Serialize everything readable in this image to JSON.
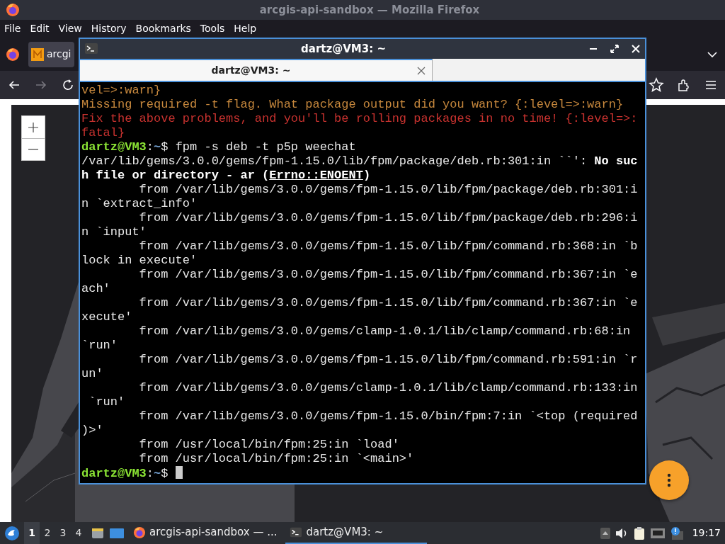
{
  "firefox": {
    "title": "arcgis-api-sandbox — Mozilla Firefox",
    "menu": [
      "File",
      "Edit",
      "View",
      "History",
      "Bookmarks",
      "Tools",
      "Help"
    ],
    "tab": {
      "label": "arcgi"
    }
  },
  "terminal": {
    "title": "dartz@VM3: ~",
    "tabs": [
      {
        "label": "dartz@VM3: ~",
        "selected": true
      }
    ],
    "cursor_visible": true,
    "lines": [
      [
        {
          "text": "vel=>:warn}",
          "kind": "warn"
        }
      ],
      [
        {
          "text": "Missing required -t flag. What package output did you want? {:level=>:warn}",
          "kind": "warn"
        }
      ],
      [
        {
          "text": "Fix the above problems, and you'll be rolling packages in no time! {:level=>:",
          "kind": "error"
        }
      ],
      [
        {
          "text": "fatal}",
          "kind": "error"
        }
      ],
      [
        {
          "text": "dartz@VM3",
          "kind": "user"
        },
        {
          "text": ":",
          "kind": "plain"
        },
        {
          "text": "~",
          "kind": "path"
        },
        {
          "text": "$ fpm -s deb -t p5p weechat",
          "kind": "plain"
        }
      ],
      [
        {
          "text": "/var/lib/gems/3.0.0/gems/fpm-1.15.0/lib/fpm/package/deb.rb:301:in ``': ",
          "kind": "plain"
        },
        {
          "text": "No suc",
          "kind": "bold"
        }
      ],
      [
        {
          "text": "h file or directory - ar (",
          "kind": "bold"
        },
        {
          "text": "Errno::ENOENT",
          "kind": "link"
        },
        {
          "text": ")",
          "kind": "bold"
        }
      ],
      [
        {
          "text": "        from /var/lib/gems/3.0.0/gems/fpm-1.15.0/lib/fpm/package/deb.rb:301:i",
          "kind": "plain"
        }
      ],
      [
        {
          "text": "n `extract_info'",
          "kind": "plain"
        }
      ],
      [
        {
          "text": "        from /var/lib/gems/3.0.0/gems/fpm-1.15.0/lib/fpm/package/deb.rb:296:i",
          "kind": "plain"
        }
      ],
      [
        {
          "text": "n `input'",
          "kind": "plain"
        }
      ],
      [
        {
          "text": "        from /var/lib/gems/3.0.0/gems/fpm-1.15.0/lib/fpm/command.rb:368:in `b",
          "kind": "plain"
        }
      ],
      [
        {
          "text": "lock in execute'",
          "kind": "plain"
        }
      ],
      [
        {
          "text": "        from /var/lib/gems/3.0.0/gems/fpm-1.15.0/lib/fpm/command.rb:367:in `e",
          "kind": "plain"
        }
      ],
      [
        {
          "text": "ach'",
          "kind": "plain"
        }
      ],
      [
        {
          "text": "        from /var/lib/gems/3.0.0/gems/fpm-1.15.0/lib/fpm/command.rb:367:in `e",
          "kind": "plain"
        }
      ],
      [
        {
          "text": "xecute'",
          "kind": "plain"
        }
      ],
      [
        {
          "text": "        from /var/lib/gems/3.0.0/gems/clamp-1.0.1/lib/clamp/command.rb:68:in",
          "kind": "plain"
        }
      ],
      [
        {
          "text": "`run'",
          "kind": "plain"
        }
      ],
      [
        {
          "text": "        from /var/lib/gems/3.0.0/gems/fpm-1.15.0/lib/fpm/command.rb:591:in `r",
          "kind": "plain"
        }
      ],
      [
        {
          "text": "un'",
          "kind": "plain"
        }
      ],
      [
        {
          "text": "        from /var/lib/gems/3.0.0/gems/clamp-1.0.1/lib/clamp/command.rb:133:in",
          "kind": "plain"
        }
      ],
      [
        {
          "text": " `run'",
          "kind": "plain"
        }
      ],
      [
        {
          "text": "        from /var/lib/gems/3.0.0/gems/fpm-1.15.0/bin/fpm:7:in `<top (required",
          "kind": "plain"
        }
      ],
      [
        {
          "text": ")>'",
          "kind": "plain"
        }
      ],
      [
        {
          "text": "        from /usr/local/bin/fpm:25:in `load'",
          "kind": "plain"
        }
      ],
      [
        {
          "text": "        from /usr/local/bin/fpm:25:in `<main>'",
          "kind": "plain"
        }
      ],
      [
        {
          "text": "dartz@VM3",
          "kind": "user"
        },
        {
          "text": ":",
          "kind": "plain"
        },
        {
          "text": "~",
          "kind": "path"
        },
        {
          "text": "$ ",
          "kind": "plain"
        }
      ]
    ]
  },
  "taskbar": {
    "workspaces": [
      {
        "label": "1",
        "selected": true
      },
      {
        "label": "2",
        "selected": false
      },
      {
        "label": "3",
        "selected": false
      },
      {
        "label": "4",
        "selected": false
      }
    ],
    "tasks": [
      {
        "label": "arcgis-api-sandbox — ...",
        "kind": "browser",
        "selected": false
      },
      {
        "label": "dartz@VM3: ~",
        "kind": "terminal",
        "selected": true
      }
    ],
    "clock": "19:17"
  }
}
